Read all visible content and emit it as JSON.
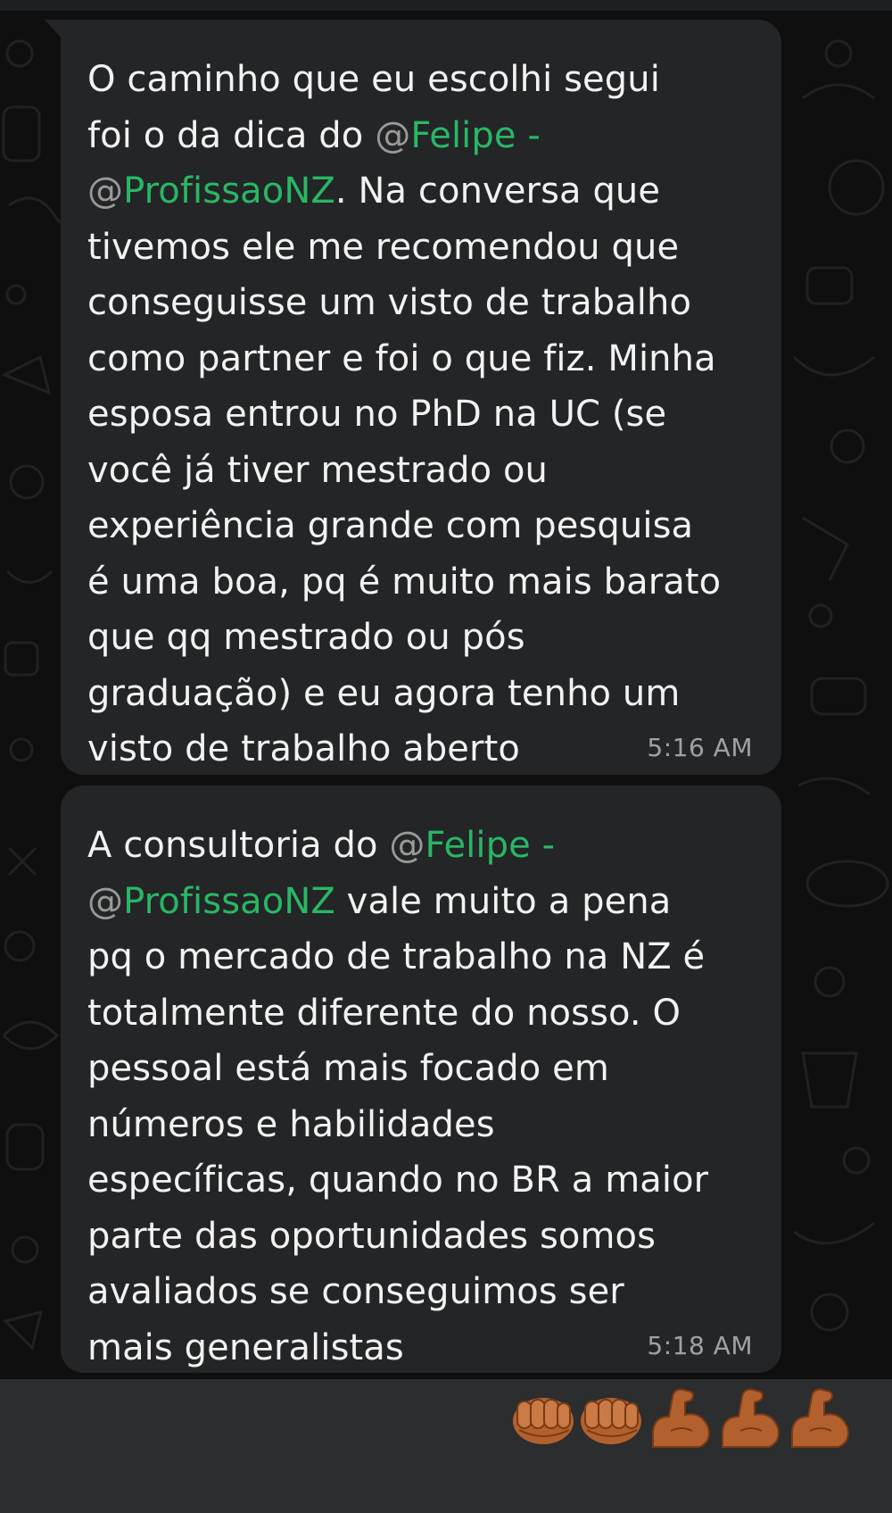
{
  "messages": [
    {
      "id": "msg1",
      "lines": [
        [
          "O caminho que eu escolhi segui"
        ],
        [
          "foi o da dica do ",
          {
            "at": "@",
            "name": "Felipe -"
          }
        ],
        [
          {
            "at": "@",
            "name": "ProfissaoNZ"
          },
          ". Na conversa que"
        ],
        [
          "tivemos ele me recomendou que"
        ],
        [
          "conseguisse um visto de trabalho"
        ],
        [
          "como partner e foi o que fiz. Minha"
        ],
        [
          "esposa entrou no PhD na UC (se"
        ],
        [
          "você já tiver mestrado ou"
        ],
        [
          "experiência grande com pesquisa"
        ],
        [
          "é uma boa, pq é muito mais barato"
        ],
        [
          "que qq mestrado ou pós"
        ],
        [
          "graduação) e eu agora tenho um"
        ],
        [
          "visto de trabalho aberto"
        ]
      ],
      "time": "5:16 AM"
    },
    {
      "id": "msg2",
      "lines": [
        [
          "A consultoria do ",
          {
            "at": "@",
            "name": "Felipe -"
          }
        ],
        [
          {
            "at": "@",
            "name": "ProfissaoNZ"
          },
          " vale muito a pena"
        ],
        [
          "pq o mercado de trabalho na NZ é"
        ],
        [
          "totalmente diferente do nosso. O"
        ],
        [
          "pessoal está mais focado em"
        ],
        [
          "números e habilidades"
        ],
        [
          "específicas, quando no BR a maior"
        ],
        [
          "parte das oportunidades somos"
        ],
        [
          "avaliados se conseguimos ser"
        ],
        [
          "mais generalistas"
        ]
      ],
      "time": "5:18 AM"
    }
  ],
  "reactions": {
    "emojis": [
      "fist-icon",
      "fist-icon",
      "flexed-biceps-icon",
      "flexed-biceps-icon",
      "flexed-biceps-icon"
    ],
    "skin_color": "#b2612e"
  },
  "colors": {
    "bubble": "#232527",
    "mention": "#29b765",
    "text": "#f2f2f2",
    "timestamp": "#9fa2a4"
  }
}
